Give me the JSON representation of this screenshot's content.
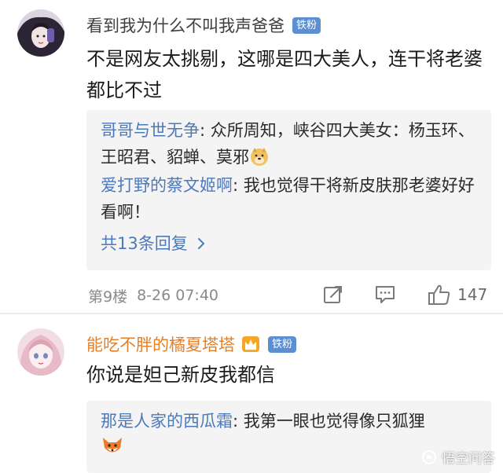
{
  "comments": [
    {
      "username": "看到我为什么不叫我声爸爸",
      "badge": "铁粉",
      "text": "不是网友太挑剔，这哪是四大美人，连干将老婆都比不过",
      "replies": [
        {
          "user": "哥哥与世无争",
          "sep": ": ",
          "text": "众所周知，峡谷四大美女：杨玉环、王昭君、貂蝉、莫邪",
          "emoji": "doge-emoji"
        },
        {
          "user": "爱打野的蔡文姬啊",
          "sep": ": ",
          "text": "我也觉得干将新皮肤那老婆好好看啊！"
        }
      ],
      "more_replies": "共13条回复",
      "floor": "第9楼",
      "time": "8-26 07:40",
      "likes": "147"
    },
    {
      "username": "能吃不胖的橘夏塔塔",
      "badge": "铁粉",
      "text": "你说是妲己新皮我都信",
      "replies": [
        {
          "user": "那是人家的西瓜霜",
          "sep": ": ",
          "text": "我第一眼也觉得像只狐狸",
          "emoji": "fox-emoji"
        }
      ]
    }
  ],
  "watermark": "悟空问答",
  "colors": {
    "link_blue": "#4b79bd",
    "vip_orange": "#e3802a",
    "badge_blue": "#5b8fd2",
    "reply_bg": "#f4f4f4",
    "meta_gray": "#8a8a8a"
  }
}
